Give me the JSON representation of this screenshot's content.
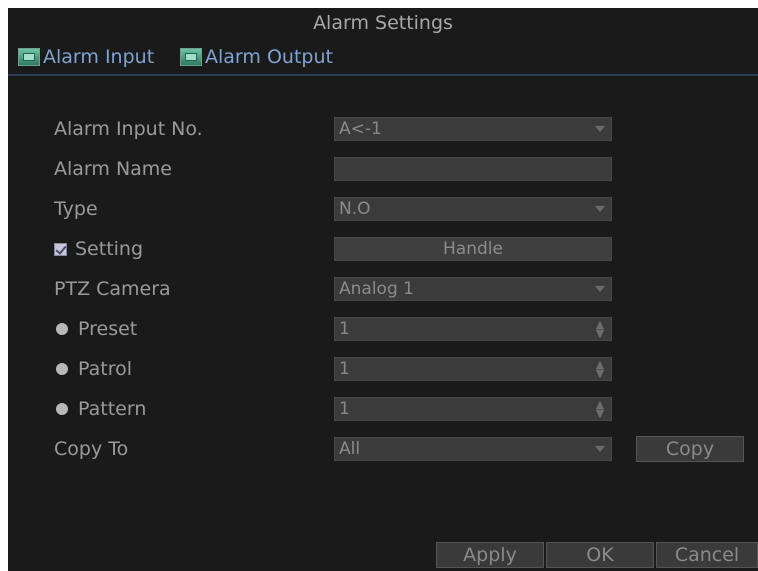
{
  "window": {
    "title": "Alarm Settings"
  },
  "tabs": [
    {
      "label": "Alarm Input",
      "icon": "alarm-input-tab-icon"
    },
    {
      "label": "Alarm Output",
      "icon": "alarm-output-tab-icon"
    }
  ],
  "form": {
    "alarm_input_no": {
      "label": "Alarm Input No.",
      "value": "A<-1"
    },
    "alarm_name": {
      "label": "Alarm Name",
      "value": ""
    },
    "type": {
      "label": "Type",
      "value": "N.O"
    },
    "setting": {
      "label": "Setting",
      "checked": true,
      "button_label": "Handle"
    },
    "ptz_camera": {
      "label": "PTZ Camera",
      "value": "Analog 1"
    },
    "preset": {
      "label": "Preset",
      "value": "1"
    },
    "patrol": {
      "label": "Patrol",
      "value": "1"
    },
    "pattern": {
      "label": "Pattern",
      "value": "1"
    },
    "copy_to": {
      "label": "Copy To",
      "value": "All",
      "button_label": "Copy"
    }
  },
  "footer": {
    "apply_label": "Apply",
    "ok_label": "OK",
    "cancel_label": "Cancel"
  },
  "colors": {
    "background": "#1a1a1a",
    "tab_text": "#7fa3d4",
    "label_text": "#9a9a9a",
    "field_bg": "#3b3b3b"
  }
}
